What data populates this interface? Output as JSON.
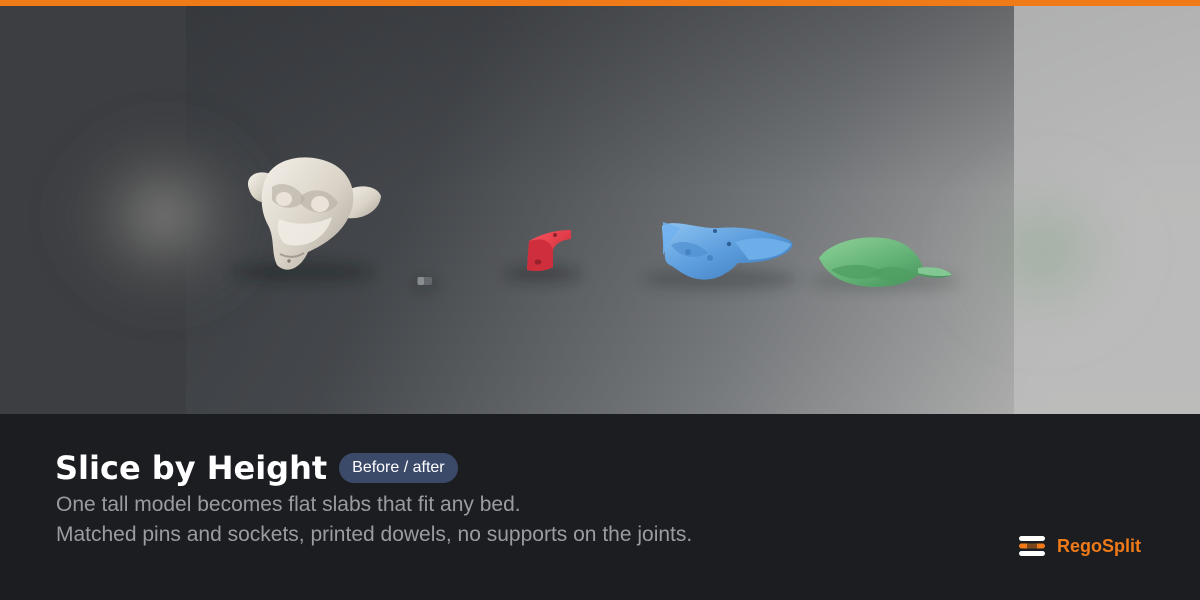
{
  "slide": {
    "title": "Slice by Height",
    "badge": "Before / after",
    "description_lines": [
      "One tall model becomes flat slabs that fit any bed.",
      "Matched pins and sockets, printed dowels, no supports on the joints."
    ],
    "brand": {
      "name": "RegoSplit",
      "icon": "stacked-slices-icon"
    }
  },
  "render": {
    "models": [
      {
        "name": "monkey-head-original",
        "color": "#ddd6cb"
      },
      {
        "name": "printed-dowel",
        "color": "#696b6f"
      },
      {
        "name": "red-slice",
        "color": "#d93843"
      },
      {
        "name": "blue-slice",
        "color": "#5c9ddd"
      },
      {
        "name": "green-slice",
        "color": "#63b275"
      }
    ]
  },
  "colors": {
    "accent": "#f07a18",
    "panel": "#1b1d21",
    "badge": "#3c4a6a",
    "title": "#ffffff",
    "body": "#9a9ca1"
  }
}
